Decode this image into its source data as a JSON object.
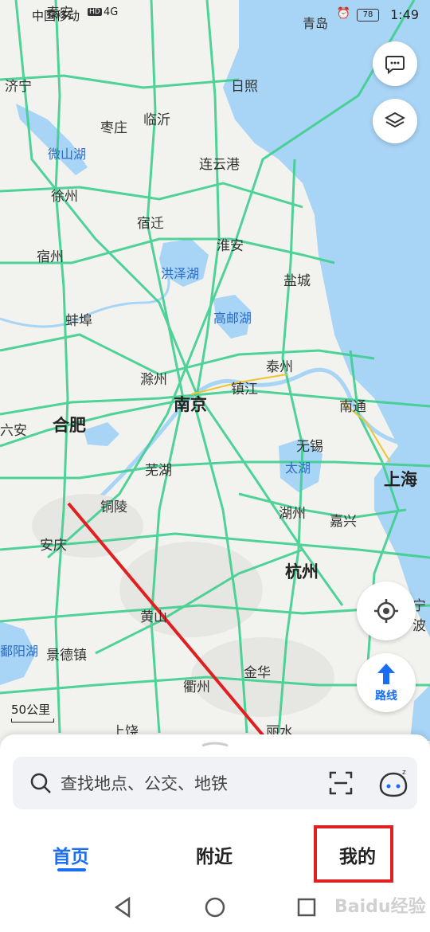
{
  "status_bar": {
    "carrier": "中国移动",
    "network_badge": "HD",
    "signal": "4G",
    "battery": "78",
    "time": "1:49"
  },
  "map": {
    "cities": [
      {
        "name": "泰安"
      },
      {
        "name": "青岛"
      },
      {
        "name": "济宁"
      },
      {
        "name": "日照"
      },
      {
        "name": "枣庄"
      },
      {
        "name": "临沂"
      },
      {
        "name": "微山湖"
      },
      {
        "name": "连云港"
      },
      {
        "name": "徐州"
      },
      {
        "name": "宿迁"
      },
      {
        "name": "淮安"
      },
      {
        "name": "宿州"
      },
      {
        "name": "洪泽湖"
      },
      {
        "name": "盐城"
      },
      {
        "name": "蚌埠"
      },
      {
        "name": "高邮湖"
      },
      {
        "name": "泰州"
      },
      {
        "name": "滁州"
      },
      {
        "name": "南京"
      },
      {
        "name": "镇江"
      },
      {
        "name": "南通"
      },
      {
        "name": "六安"
      },
      {
        "name": "合肥"
      },
      {
        "name": "无锡"
      },
      {
        "name": "芜湖"
      },
      {
        "name": "太湖"
      },
      {
        "name": "上海"
      },
      {
        "name": "铜陵"
      },
      {
        "name": "湖州"
      },
      {
        "name": "嘉兴"
      },
      {
        "name": "安庆"
      },
      {
        "name": "杭州"
      },
      {
        "name": "黄山"
      },
      {
        "name": "鄱阳湖"
      },
      {
        "name": "景德镇"
      },
      {
        "name": "宁波"
      },
      {
        "name": "金华"
      },
      {
        "name": "衢州"
      },
      {
        "name": "上饶"
      },
      {
        "name": "丽水"
      }
    ],
    "scale_label": "50公里",
    "water_color": "#a8d4f5",
    "road_color": "#3ecf8e"
  },
  "buttons": {
    "feedback_icon": "message-icon",
    "layers_icon": "layers-icon",
    "locate_icon": "locate-icon",
    "route_label": "路线"
  },
  "search": {
    "placeholder": "查找地点、公交、地铁",
    "scan_icon": "scan-icon",
    "assistant_icon": "assistant-icon"
  },
  "tabs": [
    {
      "label": "首页",
      "active": true
    },
    {
      "label": "附近",
      "active": false
    },
    {
      "label": "我的",
      "active": false
    }
  ],
  "annotation": {
    "color": "#e02020"
  },
  "watermark": "Baidu经验"
}
